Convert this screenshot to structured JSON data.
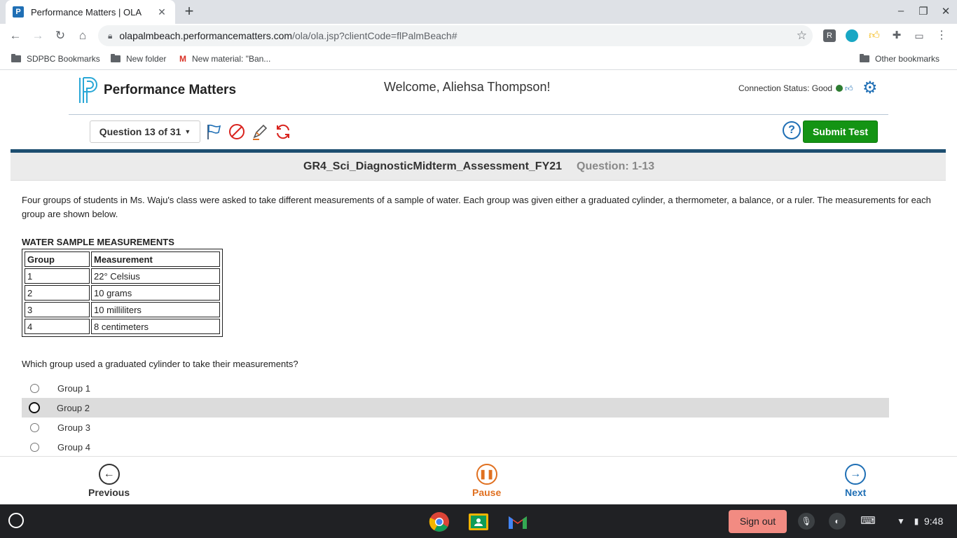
{
  "browser": {
    "tab_title": "Performance Matters | OLA",
    "tab_favicon": "P",
    "url_host": "olapalmbeach.performancematters.com",
    "url_path": "/ola/ola.jsp?clientCode=flPalmBeach#",
    "bookmarks": [
      "SDPBC Bookmarks",
      "New folder",
      "New material: \"Ban...",
      "Other bookmarks"
    ],
    "extensions": [
      "R"
    ]
  },
  "app": {
    "logo_text": "Performance Matters",
    "welcome": "Welcome, Aliehsa Thompson!",
    "connection_status": "Connection Status: Good",
    "question_selector": "Question 13 of 31",
    "help_label": "?",
    "submit_label": "Submit Test"
  },
  "question": {
    "test_name": "GR4_Sci_DiagnosticMidterm_Assessment_FY21",
    "question_number": "Question: 1-13",
    "passage": "Four groups of students in Ms. Waju's class were asked to take different measurements of a sample of water. Each group was given either a graduated cylinder, a thermometer, a balance, or a ruler. The measurements for each group are shown below.",
    "table_caption": "WATER SAMPLE MEASUREMENTS",
    "table_headers": [
      "Group",
      "Measurement"
    ],
    "table_rows": [
      [
        "1",
        "22° Celsius"
      ],
      [
        "2",
        "10 grams"
      ],
      [
        "3",
        "10 milliliters"
      ],
      [
        "4",
        "8 centimeters"
      ]
    ],
    "prompt": "Which group used a graduated cylinder to take their measurements?",
    "choices": [
      "Group 1",
      "Group 2",
      "Group 3",
      "Group 4"
    ],
    "selected_choice": "Group 2"
  },
  "footer": {
    "previous": "Previous",
    "pause": "Pause",
    "next": "Next"
  },
  "taskbar": {
    "sign_out": "Sign out",
    "time": "9:48"
  },
  "colors": {
    "brand_blue": "#1f6fb5",
    "submit_green": "#149414",
    "pause_orange": "#e07020",
    "accent_bar": "#1d4e70"
  }
}
